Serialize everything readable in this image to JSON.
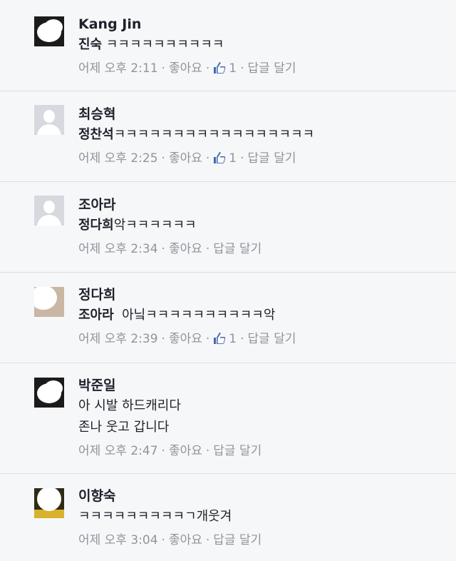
{
  "like_label": "좋아요",
  "reply_label": "답글 달기",
  "colors": {
    "meta": "#90949c",
    "like_blue": "#4267b2",
    "text": "#1d2129"
  },
  "comments": [
    {
      "author": "Kang Jin",
      "tag": "진숙",
      "text": " ㅋㅋㅋㅋㅋㅋㅋㅋㅋㅋ",
      "time": "어제 오후 2:11",
      "likes": "1",
      "avatar": "dark-photo"
    },
    {
      "author": "최승혁",
      "tag": "정찬석",
      "text": "ㅋㅋㅋㅋㅋㅋㅋㅋㅋㅋㅋㅋㅋㅋㅋㅋㅋ",
      "time": "어제 오후 2:25",
      "likes": "1",
      "avatar": "default-silhouette"
    },
    {
      "author": "조아라",
      "tag": "정다희",
      "text": "악ㅋㅋㅋㅋㅋㅋ",
      "time": "어제 오후 2:34",
      "avatar": "default-silhouette"
    },
    {
      "author": "정다희",
      "tag": "조아라",
      "text": "  아닠ㅋㅋㅋㅋㅋㅋㅋㅋㅋㅋ악",
      "time": "어제 오후 2:39",
      "likes": "1",
      "avatar": "photo"
    },
    {
      "author": "박준일",
      "text_lines": [
        "아 시발 하드캐리다",
        "존나 웃고 갑니다"
      ],
      "time": "어제 오후 2:47",
      "avatar": "dark-photo"
    },
    {
      "author": "이향숙",
      "text": "ㅋㅋㅋㅋㅋㅋㅋㅋㅋㄱ개웃겨",
      "time": "어제 오후 3:04",
      "avatar": "yellow-photo"
    }
  ]
}
